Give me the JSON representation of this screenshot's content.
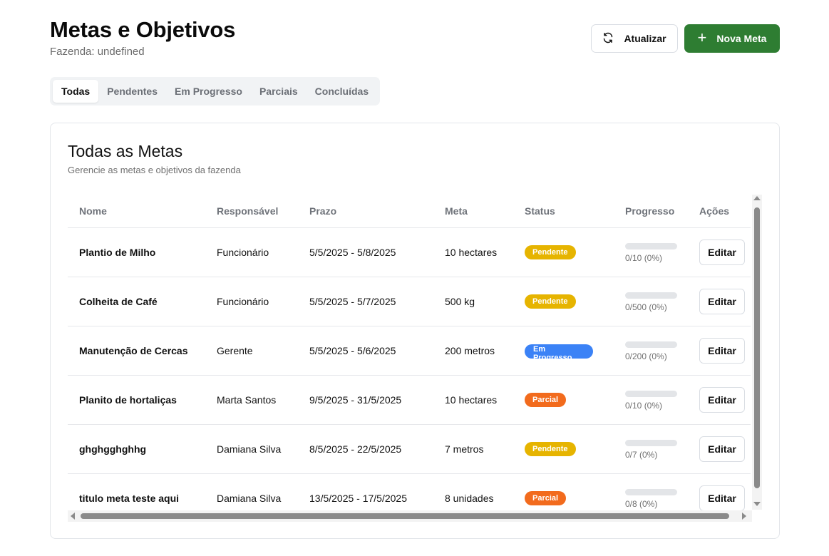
{
  "header": {
    "title": "Metas e Objetivos",
    "subtitle": "Fazenda: undefined",
    "refresh_label": "Atualizar",
    "refresh_icon": "refresh-icon",
    "new_label": "Nova Meta",
    "new_icon": "plus-icon"
  },
  "tabs": [
    {
      "label": "Todas",
      "active": true
    },
    {
      "label": "Pendentes",
      "active": false
    },
    {
      "label": "Em Progresso",
      "active": false
    },
    {
      "label": "Parciais",
      "active": false
    },
    {
      "label": "Concluídas",
      "active": false
    }
  ],
  "card": {
    "title": "Todas as Metas",
    "description": "Gerencie as metas e objetivos da fazenda"
  },
  "table": {
    "columns": [
      "Nome",
      "Responsável",
      "Prazo",
      "Meta",
      "Status",
      "Progresso",
      "Ações"
    ],
    "edit_label": "Editar",
    "rows": [
      {
        "nome": "Plantio de Milho",
        "responsavel": "Funcionário",
        "prazo": "5/5/2025 - 5/8/2025",
        "meta": "10 hectares",
        "status": "Pendente",
        "status_type": "pendente",
        "progress_text": "0/10 (0%)",
        "progress": 0
      },
      {
        "nome": "Colheita de Café",
        "responsavel": "Funcionário",
        "prazo": "5/5/2025 - 5/7/2025",
        "meta": "500 kg",
        "status": "Pendente",
        "status_type": "pendente",
        "progress_text": "0/500 (0%)",
        "progress": 0
      },
      {
        "nome": "Manutenção de Cercas",
        "responsavel": "Gerente",
        "prazo": "5/5/2025 - 5/6/2025",
        "meta": "200 metros",
        "status": "Em Progresso",
        "status_type": "progresso",
        "progress_text": "0/200 (0%)",
        "progress": 0
      },
      {
        "nome": "Planito de hortaliças",
        "responsavel": "Marta Santos",
        "prazo": "9/5/2025 - 31/5/2025",
        "meta": "10 hectares",
        "status": "Parcial",
        "status_type": "parcial",
        "progress_text": "0/10 (0%)",
        "progress": 0
      },
      {
        "nome": "ghghgghghhg",
        "responsavel": "Damiana Silva",
        "prazo": "8/5/2025 - 22/5/2025",
        "meta": "7 metros",
        "status": "Pendente",
        "status_type": "pendente",
        "progress_text": "0/7 (0%)",
        "progress": 0
      },
      {
        "nome": "titulo meta teste aqui",
        "responsavel": "Damiana Silva",
        "prazo": "13/5/2025 - 17/5/2025",
        "meta": "8 unidades",
        "status": "Parcial",
        "status_type": "parcial",
        "progress_text": "0/8 (0%)",
        "progress": 0
      }
    ]
  },
  "colors": {
    "primary": "#2e7d32",
    "pendente": "#e6b400",
    "progresso": "#3b82f6",
    "parcial": "#f26b1d"
  }
}
